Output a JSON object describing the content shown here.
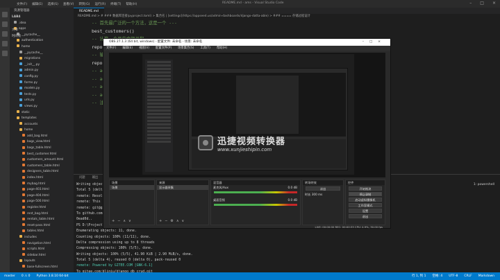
{
  "vscode": {
    "window_title": "README.md - ams - Visual Studio Code",
    "menu": [
      "文件(F)",
      "编辑(E)",
      "选择(S)",
      "查看(V)",
      "转到(G)",
      "运行(R)",
      "终端(T)",
      "帮助(H)"
    ],
    "explorer": {
      "header": "资源管理器",
      "root": "LAB4",
      "items": [
        {
          "label": ".idea",
          "color": "#9e9e9e"
        },
        {
          "label": "apps",
          "color": "#e8b04b"
        },
        {
          "label": "__pycache__",
          "color": "#9e9e9e"
        },
        {
          "label": "authentication",
          "color": "#e8b04b"
        },
        {
          "label": "home",
          "color": "#e8b04b"
        },
        {
          "label": "__pycache__",
          "color": "#9e9e9e"
        },
        {
          "label": "migrations",
          "color": "#e8b04b"
        },
        {
          "label": "__init__.py",
          "color": "#4a9fd8"
        },
        {
          "label": "admin.py",
          "color": "#4a9fd8"
        },
        {
          "label": "config.py",
          "color": "#4a9fd8"
        },
        {
          "label": "forms.py",
          "color": "#4a9fd8"
        },
        {
          "label": "models.py",
          "color": "#4a9fd8"
        },
        {
          "label": "tests.py",
          "color": "#4a9fd8"
        },
        {
          "label": "urls.py",
          "color": "#4a9fd8"
        },
        {
          "label": "views.py",
          "color": "#4a9fd8"
        },
        {
          "label": "static",
          "color": "#e8b04b"
        },
        {
          "label": "templates",
          "color": "#e8b04b"
        },
        {
          "label": "accounts",
          "color": "#e8b04b"
        },
        {
          "label": "home",
          "color": "#e8b04b"
        },
        {
          "label": "add_bag.html",
          "color": "#e37933"
        },
        {
          "label": "bags_view.html",
          "color": "#e37933"
        },
        {
          "label": "bags_table.html",
          "color": "#e37933"
        },
        {
          "label": "best_customer.html",
          "color": "#e37933"
        },
        {
          "label": "customers_amount.html",
          "color": "#e37933"
        },
        {
          "label": "customers_table.html",
          "color": "#e37933"
        },
        {
          "label": "designers_table.html",
          "color": "#e37933"
        },
        {
          "label": "index.html",
          "color": "#e37933"
        },
        {
          "label": "mybag.html",
          "color": "#e37933"
        },
        {
          "label": "page-403.html",
          "color": "#e37933"
        },
        {
          "label": "page-404.html",
          "color": "#e37933"
        },
        {
          "label": "page-500.html",
          "color": "#e37933"
        },
        {
          "label": "register.html",
          "color": "#e37933"
        },
        {
          "label": "rent_bag.html",
          "color": "#e37933"
        },
        {
          "label": "rentals_table.html",
          "color": "#e37933"
        },
        {
          "label": "reset-pass.html",
          "color": "#e37933"
        },
        {
          "label": "tables.html",
          "color": "#e37933"
        },
        {
          "label": "includes",
          "color": "#e8b04b"
        },
        {
          "label": "navigation.html",
          "color": "#e37933"
        },
        {
          "label": "scripts.html",
          "color": "#e37933"
        },
        {
          "label": "sidebar.html",
          "color": "#e37933"
        },
        {
          "label": "layouts",
          "color": "#e8b04b"
        },
        {
          "label": "base-fullscreen.html",
          "color": "#e37933"
        }
      ],
      "outline": "大纲",
      "timeline": "时间线"
    },
    "tab": "README.md",
    "breadcrumb": "README.md > # ### 数据库连接(pyproject.toml) > 集合名 | [settings](https://appseed.us/admin-dashboards/django-datta-able) > ### ==== 存储过程设计",
    "code": [
      {
        "ln": "",
        "text": "-- 首先最广泛的一个方法，这是一个 ---",
        "cls": "c"
      },
      {
        "ln": "",
        "text": "best_customers()",
        "cls": "n"
      },
      {
        "ln": "",
        "text": "-- 计算一个月内金额总和 ---",
        "cls": "c"
      },
      {
        "ln": "",
        "text": "report_",
        "cls": "n"
      },
      {
        "ln": "",
        "text": "-- 输入 ---",
        "cls": "c"
      },
      {
        "ln": "",
        "text": "report_",
        "cls": "n"
      },
      {
        "ln": "",
        "text": "-- add_ren",
        "cls": "c"
      },
      {
        "ln": "",
        "text": "-- add_bag",
        "cls": "c"
      },
      {
        "ln": "",
        "text": "-- add_des",
        "cls": "c"
      },
      {
        "ln": "",
        "text": "-- add_cus",
        "cls": "c"
      },
      {
        "ln": "",
        "text": "-- 注： la",
        "cls": "c"
      }
    ],
    "terminal": {
      "tabs": [
        "问题",
        "输出",
        "调试控制台",
        "终端"
      ],
      "shell": "1: powershell",
      "lines": [
        "Writing objects",
        "Total 5 (delta 4), reused 0",
        "remote: Resolving",
        "remote: This rep",
        "remote:   git@gi",
        "To github.com:bl",
        "   0ead0d..",
        "PS D:\\Project\\",
        "Enumerating objects: 11, done.",
        "Counting objects: 100% (11/11), done.",
        "Delta compression using up to 8 threads",
        "Compressing objects: 100% (5/5), done.",
        "Writing objects: 100% (5/5), 41.90 KiB | 2.90 MiB/s, done.",
        "Total 5 (delta 4), reused 0 (delta 0), pack-reused 0",
        "remote: Powered by GITEE.COM [GNK-6.1]",
        "To gitee.com:bliniu/django_db_crud.git",
        "   0ead0d..1m6a0cf  master -> master",
        "PS D:\\Project\\DB\\lab4\\lab4> python manage"
      ]
    },
    "status": {
      "left": [
        "master",
        "0 ⚠ 0",
        "Python 3.8.10 64-bit"
      ],
      "right": [
        "行 1, 列 1",
        "空格: 4",
        "UTF-8",
        "CRLF",
        "Markdown"
      ]
    }
  },
  "obs": {
    "title": "OBS 27.1.3 (64 bit, windows) - 配置文件: 未命名 - 场景: 未命名",
    "menu": [
      "文件(F)",
      "编辑(E)",
      "视图(V)",
      "配置文件(P)",
      "场景集合(S)",
      "工具(T)",
      "帮助(H)"
    ],
    "docks": {
      "scenes": {
        "title": "场景",
        "items": [
          "场景"
        ]
      },
      "sources": {
        "title": "来源",
        "items": [
          "显示器采集"
        ]
      },
      "mixer": {
        "title": "混音器",
        "channels": [
          {
            "name": "麦克风/Aux",
            "db": "0.0 dB"
          },
          {
            "name": "桌面音频",
            "db": "0.0 dB"
          }
        ]
      },
      "transitions": {
        "title": "转场特效",
        "type": "淡出",
        "duration_label": "时长",
        "duration": "300 ms"
      },
      "controls": {
        "title": "控件",
        "buttons": [
          "开始推流",
          "停止录制",
          "启动虚拟摄像机",
          "工作室模式",
          "设置",
          "退出"
        ]
      }
    },
    "status_text": "LIVE: 00:00:00  REC: 00:00:33  CPU: 4.9%, 30.00 fps"
  },
  "watermark": {
    "name": "迅捷视频转换器",
    "url": "www.xunjieshipin.com"
  }
}
